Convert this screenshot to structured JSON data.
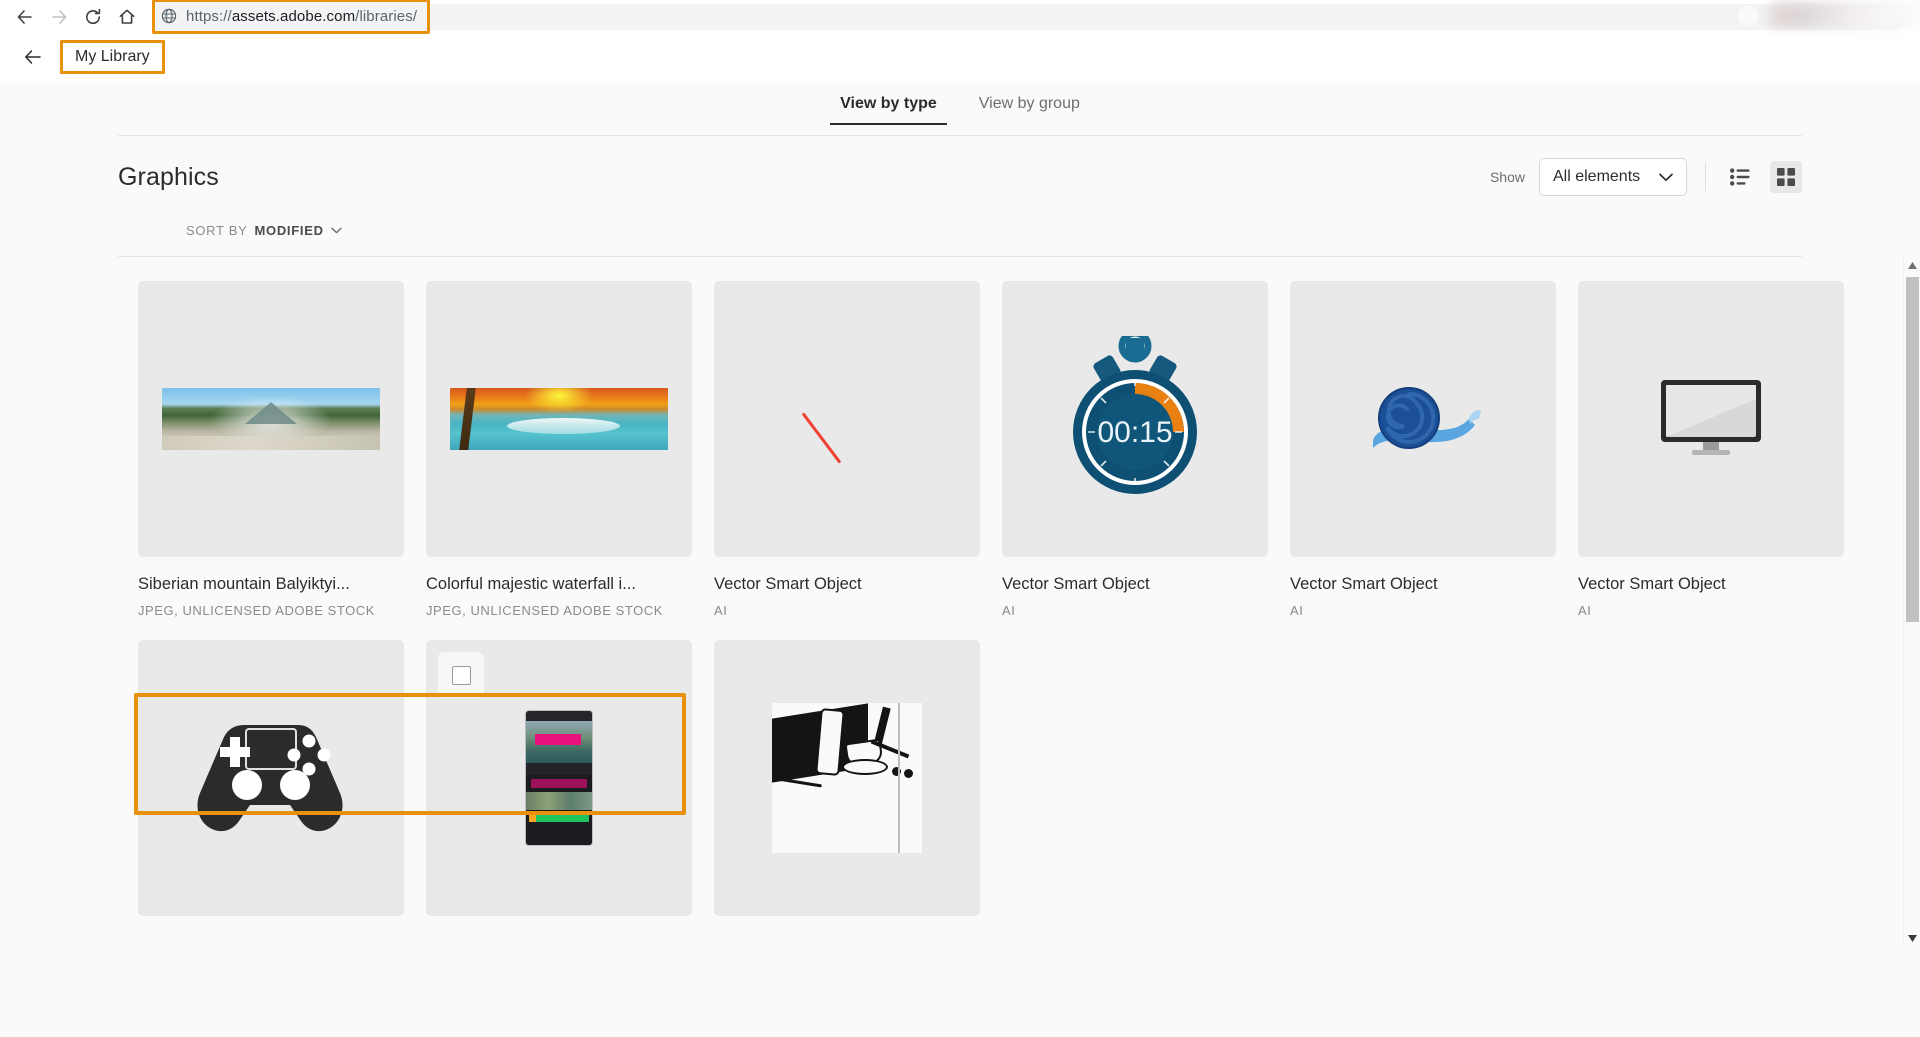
{
  "browser": {
    "back_icon": "back-arrow-icon",
    "forward_icon": "forward-arrow-icon",
    "reload_icon": "reload-icon",
    "home_icon": "home-icon",
    "site_icon": "globe-icon",
    "url_prefix": "https://",
    "url_domain": "assets.adobe.com",
    "url_path": "/libraries/",
    "url_full": "https://assets.adobe.com/libraries/",
    "highlight_color": "#e8920b"
  },
  "app_header": {
    "back_icon": "back-arrow-icon",
    "library_label": "My Library"
  },
  "tabs": [
    {
      "label": "View by type",
      "active": true
    },
    {
      "label": "View by group",
      "active": false
    }
  ],
  "section": {
    "title": "Graphics",
    "show_label": "Show",
    "filter_value": "All elements",
    "filter_chevron": "chevron-down-icon",
    "list_view_icon": "list-view-icon",
    "grid_view_icon": "grid-view-icon",
    "active_view": "grid"
  },
  "sort": {
    "prefix": "SORT BY",
    "value": "MODIFIED",
    "chevron": "chevron-down-icon"
  },
  "assets": [
    {
      "title": "Siberian mountain Balyiktyi...",
      "meta": "JPEG, UNLICENSED ADOBE STOCK",
      "thumb": "mountain-panorama",
      "selected": true
    },
    {
      "title": "Colorful majestic waterfall i...",
      "meta": "JPEG, UNLICENSED ADOBE STOCK",
      "thumb": "waterfall-panorama",
      "selected": true
    },
    {
      "title": "Vector Smart Object",
      "meta": "AI",
      "thumb": "red-diagonal-line",
      "selected": false
    },
    {
      "title": "Vector Smart Object",
      "meta": "AI",
      "thumb": "stopwatch",
      "stopwatch_time": "00:15",
      "selected": false
    },
    {
      "title": "Vector Smart Object",
      "meta": "AI",
      "thumb": "snail",
      "selected": false
    },
    {
      "title": "Vector Smart Object",
      "meta": "AI",
      "thumb": "monitor",
      "selected": false
    },
    {
      "title": "",
      "meta": "",
      "thumb": "gamepad",
      "selected": false
    },
    {
      "title": "",
      "meta": "",
      "thumb": "phone-mockup",
      "selected": false,
      "checkbox": true
    },
    {
      "title": "",
      "meta": "",
      "thumb": "sketch-drawing",
      "selected": false
    }
  ],
  "scrollbar": {
    "up_icon": "scroll-up-arrow-icon",
    "down_icon": "scroll-down-arrow-icon"
  }
}
